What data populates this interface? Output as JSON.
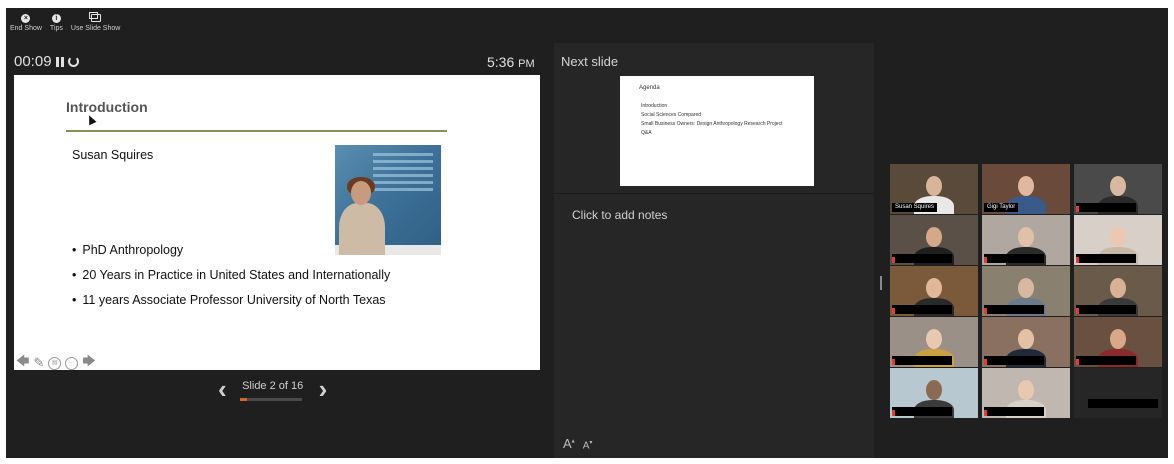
{
  "toolbar": {
    "end_show": "End Show",
    "tips": "Tips",
    "use_slide_show": "Use Slide Show"
  },
  "presenter": {
    "elapsed": "00:09",
    "clock_time": "5:36",
    "clock_ampm": "PM"
  },
  "current_slide": {
    "title": "Introduction",
    "name": "Susan Squires",
    "bullets": [
      "PhD Anthropology",
      "20 Years in Practice in United States and Internationally",
      "11 years Associate Professor University of North Texas"
    ]
  },
  "navigation": {
    "slide_label": "Slide 2 of 16",
    "current": 2,
    "total": 16
  },
  "next_slide": {
    "label": "Next slide",
    "title": "Agenda",
    "items": [
      "Introduction",
      "Social Sciences Compared",
      "Small Business Owners: Design Anthropology Research Project",
      "Q&A"
    ]
  },
  "notes": {
    "placeholder": "Click to add notes"
  },
  "font_controls": {
    "increase": "A",
    "decrease": "A"
  },
  "gallery": {
    "tiles": [
      {
        "name": "Susan Squires",
        "bg": "#5a4a3a",
        "skin": "#d8b49a",
        "shirt": "#e8e8e8",
        "active": true
      },
      {
        "name": "Gigi Taylor",
        "bg": "#6a4a3a",
        "skin": "#e0b8a0",
        "shirt": "#3a5a8a",
        "active": false
      },
      {
        "name": "",
        "bg": "#4a4a4a",
        "skin": "#d8b8a0",
        "shirt": "#2a2a2a",
        "active": false
      },
      {
        "name": "",
        "bg": "#5a5048",
        "skin": "#d4a888",
        "shirt": "#1f1f1f",
        "active": false
      },
      {
        "name": "",
        "bg": "#b0a8a0",
        "skin": "#e0c0a8",
        "shirt": "#2a2a2a",
        "active": false
      },
      {
        "name": "",
        "bg": "#d8d0c8",
        "skin": "#ecc8b0",
        "shirt": "#c8b8a8",
        "active": false
      },
      {
        "name": "",
        "bg": "#7a5a3a",
        "skin": "#e0b898",
        "shirt": "#2a2a2a",
        "active": false
      },
      {
        "name": "",
        "bg": "#8a8070",
        "skin": "#d8b8a0",
        "shirt": "#6a7a8a",
        "active": false
      },
      {
        "name": "",
        "bg": "#6a5a4a",
        "skin": "#d8b094",
        "shirt": "#3a3a3a",
        "active": false
      },
      {
        "name": "",
        "bg": "#9a9088",
        "skin": "#e8c8b0",
        "shirt": "#caa040",
        "active": false
      },
      {
        "name": "",
        "bg": "#8a7060",
        "skin": "#e4c0a4",
        "shirt": "#1f2a3a",
        "active": false
      },
      {
        "name": "",
        "bg": "#6a5040",
        "skin": "#d8a888",
        "shirt": "#8a2a2a",
        "active": false
      },
      {
        "name": "",
        "bg": "#b8c8d0",
        "skin": "#8a6a50",
        "shirt": "#3a3a3a",
        "active": false
      },
      {
        "name": "",
        "bg": "#c0b8b0",
        "skin": "#e8c8b0",
        "shirt": "#d8d0c8",
        "active": false
      },
      {
        "name": "",
        "bg": "#262626",
        "skin": "",
        "shirt": "",
        "active": false,
        "empty": true
      }
    ]
  }
}
